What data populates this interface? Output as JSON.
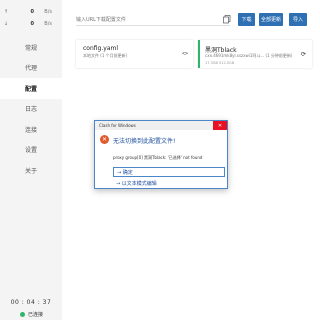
{
  "sidebar": {
    "traffic": [
      {
        "arrow": "↑",
        "value": "0",
        "unit": "B/s"
      },
      {
        "arrow": "↓",
        "value": "0",
        "unit": "B/s"
      }
    ],
    "nav": [
      "常规",
      "代理",
      "配置",
      "日志",
      "连接",
      "设置",
      "关于"
    ],
    "active_index": 2,
    "clock": "00 : 04 : 37",
    "status": "已连接",
    "status_color": "#2db56b"
  },
  "main": {
    "url_placeholder": "输入URL下载配置文件",
    "buttons": {
      "download": "下载",
      "update_all": "全部更新",
      "import": "导入"
    },
    "profiles": [
      {
        "name": "config.yaml",
        "subtitle": "本地文件 (1 个月前更新)"
      },
      {
        "name": "黑洞Tblack",
        "subtitle": "cxx.4691mk8yl.sszxwi1阿斗...  (1 分钟前更新)",
        "meta": "17.3GB   512.0GB"
      }
    ]
  },
  "dialog": {
    "title": "Clash for Windows",
    "heading": "无法切换到此配置文件!",
    "message": "proxy group[0] 黑洞Tblack: '已选择' not found",
    "ok": "→ 确定",
    "text_mode": "→ 以文本模式编辑"
  },
  "colors": {
    "accent": "#2f6fb3",
    "active_bar": "#2db56b",
    "error": "#e05a2b"
  }
}
